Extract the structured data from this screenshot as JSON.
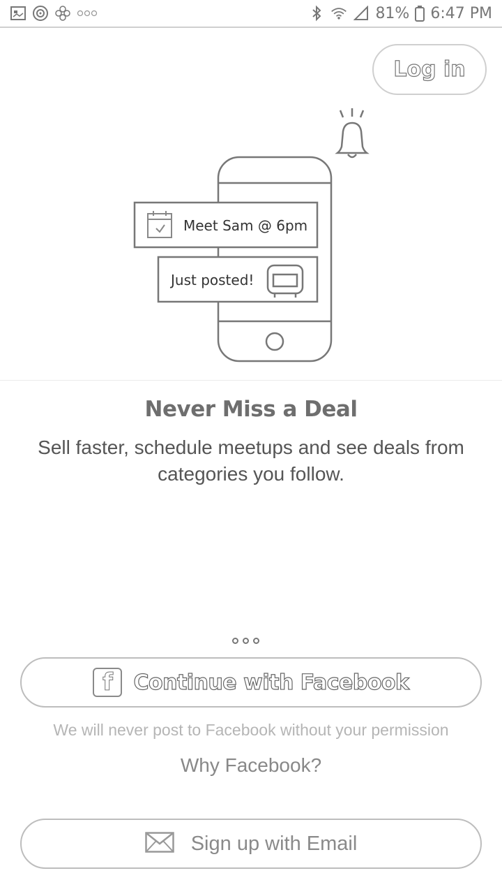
{
  "status_bar": {
    "battery": "81%",
    "time": "6:47 PM",
    "icons_left": [
      "gallery-icon",
      "target-icon",
      "flower-icon",
      "more-notifications-icon"
    ],
    "icons_right": [
      "bluetooth-icon",
      "wifi-icon",
      "signal-icon",
      "battery-icon"
    ]
  },
  "header": {
    "login_label": "Log in"
  },
  "illustration": {
    "card1_text": "Meet Sam @ 6pm",
    "card2_text": "Just posted!"
  },
  "onboarding": {
    "title": "Never Miss a Deal",
    "subtitle_line1": "Sell faster, schedule meetups and see deals from",
    "subtitle_line2": "categories you follow.",
    "page_count": 3
  },
  "auth": {
    "facebook_label": "Continue with Facebook",
    "facebook_icon_glyph": "f",
    "facebook_note": "We will never post to Facebook without your permission",
    "why_facebook": "Why Facebook?",
    "email_label": "Sign up with Email"
  },
  "colors": {
    "background": "#ffffff",
    "button_border": "#bdbdbd",
    "text_gray": "#555555"
  }
}
